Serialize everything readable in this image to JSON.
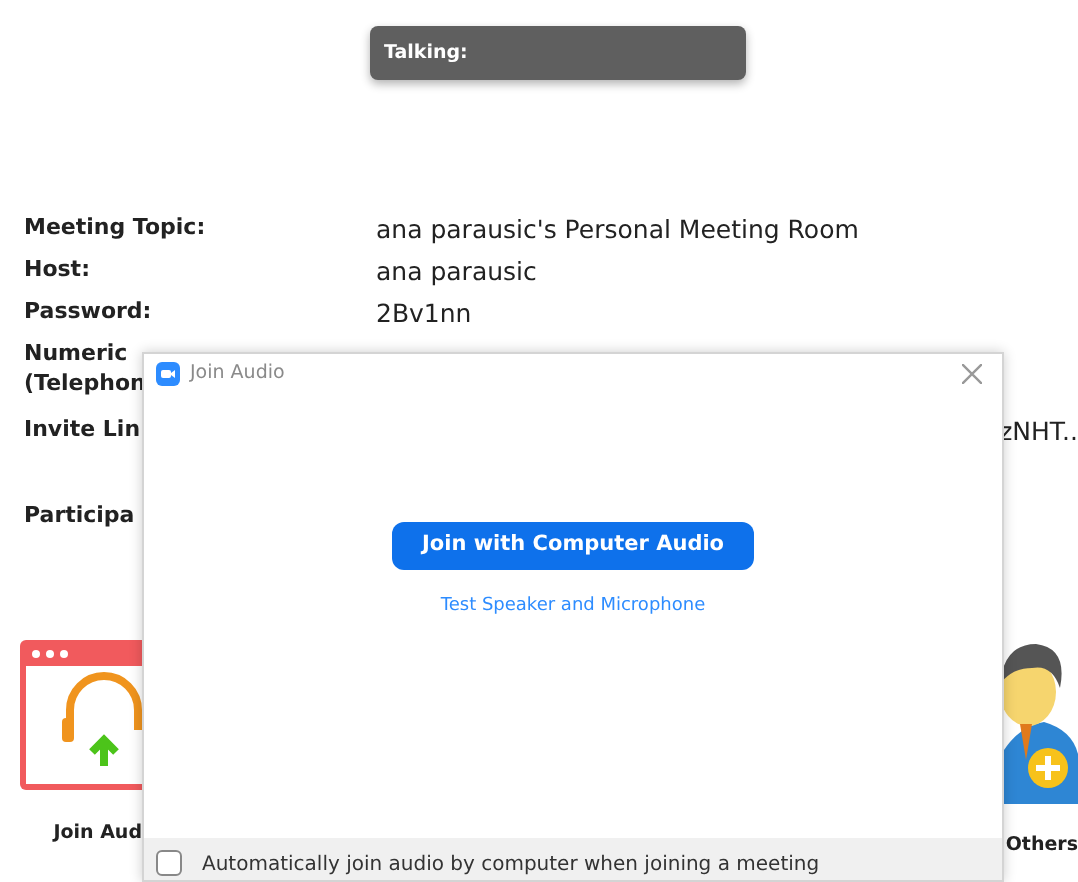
{
  "talking_bar": {
    "label": "Talking:"
  },
  "meeting_info": [
    {
      "lines": [
        "Meeting Topic:"
      ],
      "value": "ana parausic's Personal Meeting Room"
    },
    {
      "lines": [
        "Host:"
      ],
      "value": "ana parausic"
    },
    {
      "lines": [
        "Password:"
      ],
      "value": "2Bv1nn"
    },
    {
      "lines": [
        "Numeric",
        "(Telephon"
      ]
    },
    {
      "lines": [
        "Invite Lin"
      ],
      "trailing": "zNHT.."
    },
    {
      "lines": [
        "Participa"
      ]
    }
  ],
  "actions": [
    {
      "kind": "audio",
      "label": "Join Aud"
    },
    {
      "kind": "invite",
      "label": "Others"
    }
  ],
  "dialog": {
    "title": "Join Audio",
    "primary_button": "Join with Computer Audio",
    "link": "Test Speaker and Microphone",
    "auto_join": {
      "label": "Automatically join audio by computer when joining a meeting",
      "checked": false
    }
  }
}
